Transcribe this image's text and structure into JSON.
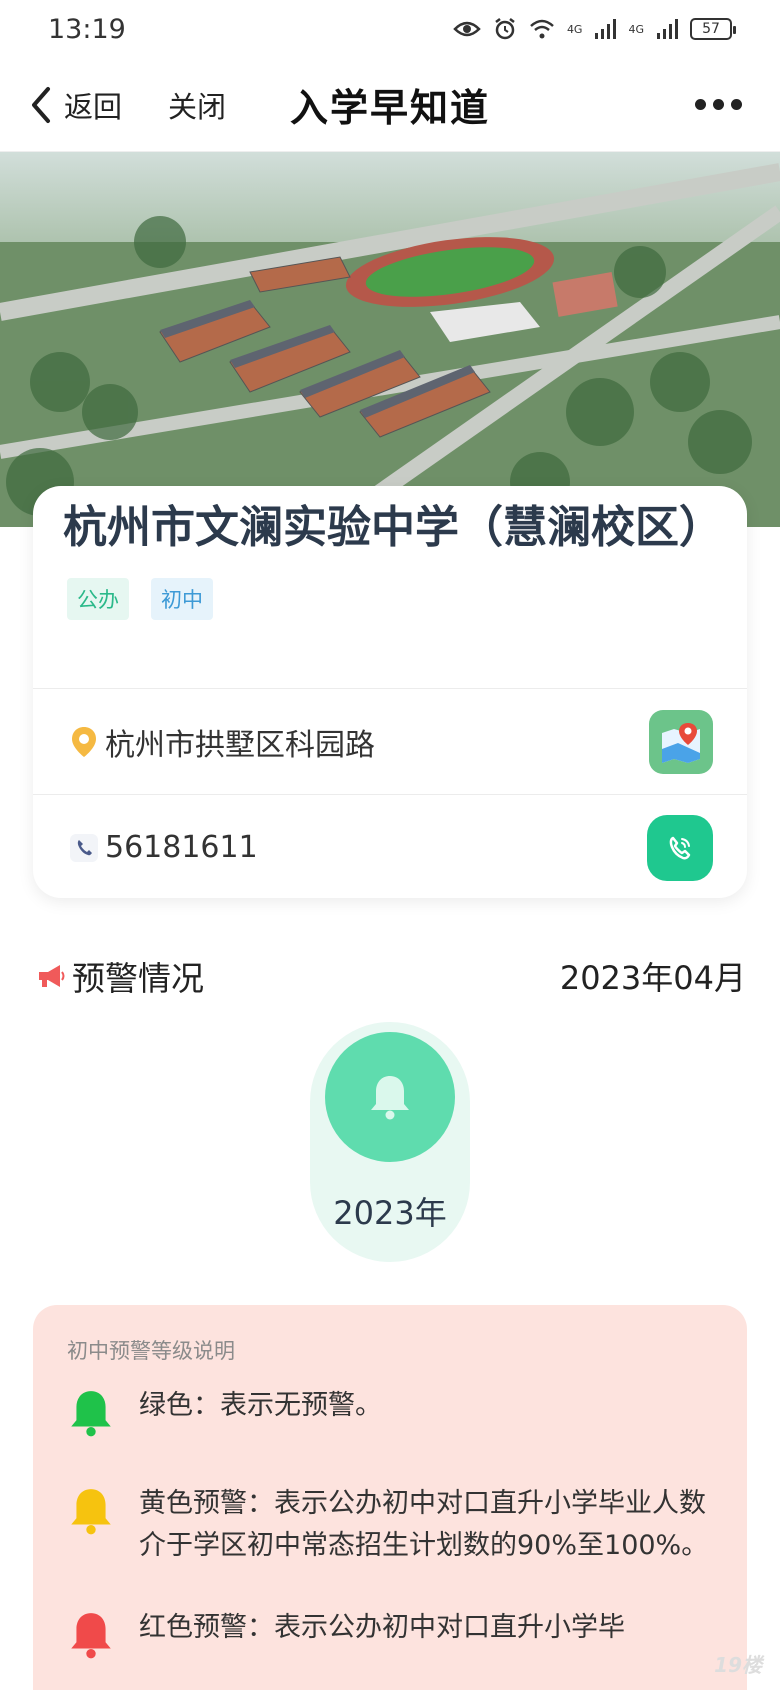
{
  "status_bar": {
    "time": "13:19",
    "signal_1": "4G",
    "signal_2": "4G",
    "battery": "57"
  },
  "nav": {
    "back_label": "返回",
    "close_label": "关闭",
    "title": "入学早知道"
  },
  "school": {
    "name": "杭州市文澜实验中学（慧澜校区）",
    "tags": [
      "公办",
      "初中"
    ],
    "address": "杭州市拱墅区科园路",
    "phone": "56181611"
  },
  "warning": {
    "title": "预警情况",
    "month": "2023年04月",
    "year": "2023年",
    "level_color": "#5fdcae"
  },
  "legend": {
    "title": "初中预警等级说明",
    "items": [
      {
        "color": "#1fc24a",
        "text": "绿色：表示无预警。"
      },
      {
        "color": "#f6c30f",
        "text": "黄色预警：表示公办初中对口直升小学毕业人数介于学区初中常态招生计划数的90%至100%。"
      },
      {
        "color": "#f04a4a",
        "text": "红色预警：表示公办初中对口直升小学毕"
      }
    ]
  },
  "watermark": "19楼"
}
